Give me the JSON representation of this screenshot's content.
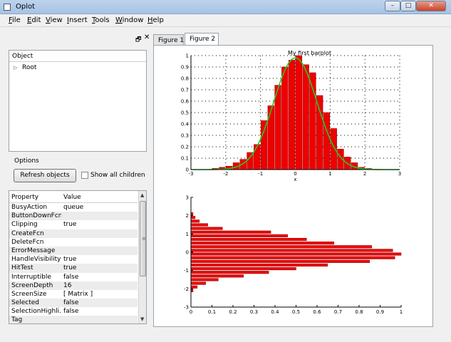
{
  "window": {
    "title": "Oplot",
    "minimize_glyph": "–",
    "maximize_glyph": "□",
    "close_glyph": "✕"
  },
  "menu": [
    "File",
    "Edit",
    "View",
    "Insert",
    "Tools",
    "Window",
    "Help"
  ],
  "dock": {
    "float_glyph": "🗗",
    "close_glyph": "✕",
    "object_header": "Object",
    "tree_arrow": "▷",
    "tree_root": "Root",
    "options_label": "Options",
    "refresh_button": "Refresh objects",
    "show_all_children": "Show all children",
    "scroll_up": "▲",
    "scroll_down": "▼",
    "scroll_grip": "≡"
  },
  "properties": {
    "header_property": "Property",
    "header_value": "Value",
    "rows": [
      [
        "BusyAction",
        "queue"
      ],
      [
        "ButtonDownFcn",
        ""
      ],
      [
        "Clipping",
        "true"
      ],
      [
        "CreateFcn",
        ""
      ],
      [
        "DeleteFcn",
        ""
      ],
      [
        "ErrorMessage",
        ""
      ],
      [
        "HandleVisibility",
        "true"
      ],
      [
        "HitTest",
        "true"
      ],
      [
        "Interruptible",
        "false"
      ],
      [
        "ScreenDepth",
        "16"
      ],
      [
        "ScreenSize",
        "[ Matrix ]"
      ],
      [
        "Selected",
        "false"
      ],
      [
        "SelectionHighli...",
        "false"
      ],
      [
        "Tag",
        ""
      ]
    ]
  },
  "tabs": [
    "Figure 1",
    "Figure 2"
  ],
  "active_tab": 1,
  "colors": {
    "bar_fill": "#ee0000",
    "bar_edge": "#880000",
    "curve": "#22cc22",
    "grid": "#000000"
  },
  "chart_data": [
    {
      "type": "bar",
      "title": "My first barplot",
      "xlabel": "x",
      "ylabel": "",
      "xlim": [
        -3,
        3
      ],
      "ylim": [
        0,
        1
      ],
      "grid": true,
      "xticks": [
        "-3",
        "-2",
        "-1",
        "0",
        "1",
        "2",
        "3"
      ],
      "yticks": [
        "0",
        "0.1",
        "0.2",
        "0.3",
        "0.4",
        "0.5",
        "0.6",
        "0.7",
        "0.8",
        "0.9",
        "1"
      ],
      "bars": [
        {
          "x": -2.3,
          "v": 0.01
        },
        {
          "x": -2.1,
          "v": 0.02
        },
        {
          "x": -1.9,
          "v": 0.03
        },
        {
          "x": -1.7,
          "v": 0.06
        },
        {
          "x": -1.5,
          "v": 0.09
        },
        {
          "x": -1.3,
          "v": 0.15
        },
        {
          "x": -1.1,
          "v": 0.22
        },
        {
          "x": -0.9,
          "v": 0.43
        },
        {
          "x": -0.7,
          "v": 0.56
        },
        {
          "x": -0.5,
          "v": 0.74
        },
        {
          "x": -0.3,
          "v": 0.9
        },
        {
          "x": -0.1,
          "v": 0.96
        },
        {
          "x": 0.1,
          "v": 1.0
        },
        {
          "x": 0.3,
          "v": 0.92
        },
        {
          "x": 0.5,
          "v": 0.85
        },
        {
          "x": 0.7,
          "v": 0.65
        },
        {
          "x": 0.9,
          "v": 0.5
        },
        {
          "x": 1.1,
          "v": 0.36
        },
        {
          "x": 1.3,
          "v": 0.18
        },
        {
          "x": 1.5,
          "v": 0.11
        },
        {
          "x": 1.7,
          "v": 0.06
        },
        {
          "x": 1.9,
          "v": 0.02
        },
        {
          "x": 2.1,
          "v": 0.01
        }
      ],
      "bar_width": 0.18,
      "curve": {
        "type": "gaussian",
        "mu": 0.0,
        "sigma": 0.62,
        "peak": 0.98
      }
    },
    {
      "type": "bar",
      "orientation": "horizontal",
      "title": "",
      "xlim": [
        0,
        1
      ],
      "ylim": [
        -3,
        3
      ],
      "grid": false,
      "xticks": [
        "0",
        "0.1",
        "0.2",
        "0.3",
        "0.4",
        "0.5",
        "0.6",
        "0.7",
        "0.8",
        "0.9",
        "1"
      ],
      "yticks": [
        "-3",
        "-2",
        "-1",
        "0",
        "1",
        "2",
        "3"
      ],
      "bars": [
        {
          "y": 2.1,
          "v": 0.01
        },
        {
          "y": 1.9,
          "v": 0.02
        },
        {
          "y": 1.7,
          "v": 0.04
        },
        {
          "y": 1.5,
          "v": 0.08
        },
        {
          "y": 1.3,
          "v": 0.15
        },
        {
          "y": 1.1,
          "v": 0.38
        },
        {
          "y": 0.9,
          "v": 0.46
        },
        {
          "y": 0.7,
          "v": 0.55
        },
        {
          "y": 0.5,
          "v": 0.68
        },
        {
          "y": 0.3,
          "v": 0.86
        },
        {
          "y": 0.1,
          "v": 0.96
        },
        {
          "y": -0.1,
          "v": 1.0
        },
        {
          "y": -0.3,
          "v": 0.97
        },
        {
          "y": -0.5,
          "v": 0.85
        },
        {
          "y": -0.7,
          "v": 0.65
        },
        {
          "y": -0.9,
          "v": 0.5
        },
        {
          "y": -1.1,
          "v": 0.37
        },
        {
          "y": -1.3,
          "v": 0.25
        },
        {
          "y": -1.5,
          "v": 0.13
        },
        {
          "y": -1.7,
          "v": 0.07
        },
        {
          "y": -1.9,
          "v": 0.03
        },
        {
          "y": -2.1,
          "v": 0.01
        }
      ],
      "bar_width": 0.14
    }
  ]
}
